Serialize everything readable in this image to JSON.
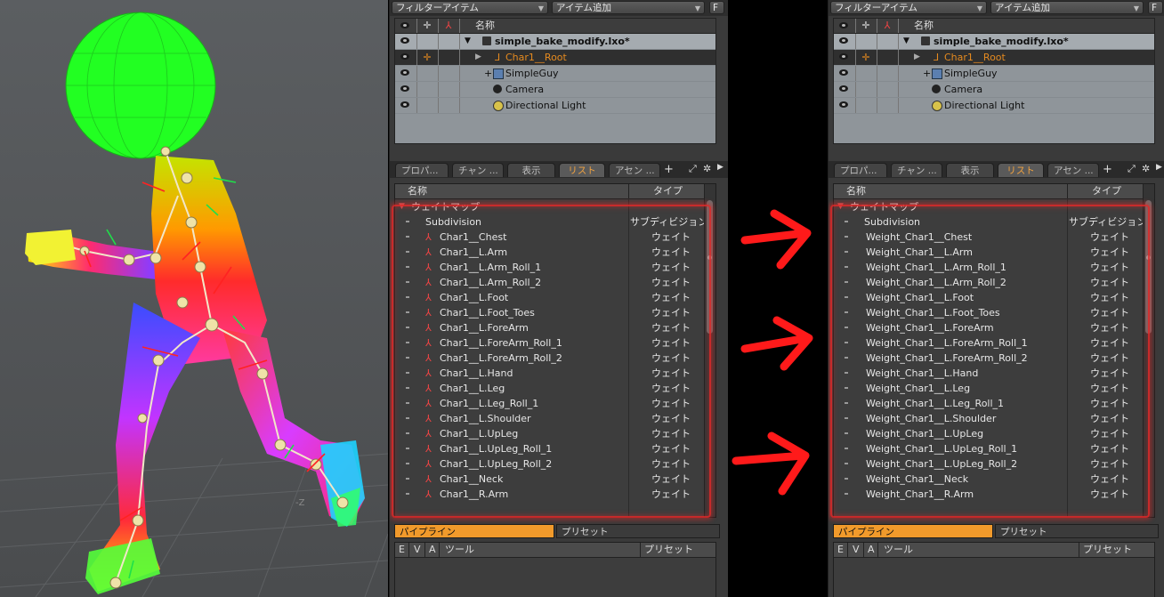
{
  "viewport": {
    "axis_label": "-Z"
  },
  "colors": {
    "panel_bg": "#3a3a3a",
    "outliner_bg": "#8f959a",
    "selected_text": "#e58a1f",
    "active_tab_text": "#f2a340",
    "pipeline_tab_bg": "#f19a2b",
    "highlight_box": "#e02828",
    "arrow": "#ff1a1a"
  },
  "toolbar": {
    "filter_label": "フィルターアイテム",
    "add_item_label": "アイテム追加",
    "f_button": "F"
  },
  "outliner": {
    "name_header": "名称",
    "scene_file": "simple_bake_modify.lxo*",
    "items": [
      {
        "label": "Char1__Root",
        "icon": "locator-icon",
        "selected": true
      },
      {
        "label": "SimpleGuy",
        "icon": "mesh-icon"
      },
      {
        "label": "Camera",
        "icon": "camera-icon"
      },
      {
        "label": "Directional Light",
        "icon": "light-icon"
      }
    ]
  },
  "tabs": [
    "プロパ...",
    "チャン ...",
    "表示",
    "リスト",
    "アセン ..."
  ],
  "active_tab": "リスト",
  "list": {
    "col_name": "名称",
    "col_type": "タイプ",
    "group": "ウェイトマップ",
    "subdivision": {
      "name": "Subdivision",
      "type": "サブディビジョン ..."
    },
    "weight_type": "ウェイト",
    "weights_left": [
      "Char1__Chest",
      "Char1__L.Arm",
      "Char1__L.Arm_Roll_1",
      "Char1__L.Arm_Roll_2",
      "Char1__L.Foot",
      "Char1__L.Foot_Toes",
      "Char1__L.ForeArm",
      "Char1__L.ForeArm_Roll_1",
      "Char1__L.ForeArm_Roll_2",
      "Char1__L.Hand",
      "Char1__L.Leg",
      "Char1__L.Leg_Roll_1",
      "Char1__L.Shoulder",
      "Char1__L.UpLeg",
      "Char1__L.UpLeg_Roll_1",
      "Char1__L.UpLeg_Roll_2",
      "Char1__Neck",
      "Char1__R.Arm"
    ],
    "weights_right": [
      "Weight_Char1__Chest",
      "Weight_Char1__L.Arm",
      "Weight_Char1__L.Arm_Roll_1",
      "Weight_Char1__L.Arm_Roll_2",
      "Weight_Char1__L.Foot",
      "Weight_Char1__L.Foot_Toes",
      "Weight_Char1__L.ForeArm",
      "Weight_Char1__L.ForeArm_Roll_1",
      "Weight_Char1__L.ForeArm_Roll_2",
      "Weight_Char1__L.Hand",
      "Weight_Char1__L.Leg",
      "Weight_Char1__L.Leg_Roll_1",
      "Weight_Char1__L.Shoulder",
      "Weight_Char1__L.UpLeg",
      "Weight_Char1__L.UpLeg_Roll_1",
      "Weight_Char1__L.UpLeg_Roll_2",
      "Weight_Char1__Neck",
      "Weight_Char1__R.Arm"
    ]
  },
  "bottom": {
    "pipeline": "パイプライン",
    "preset": "プリセット",
    "cols": [
      "E",
      "V",
      "A",
      "ツール",
      "プリセット"
    ]
  }
}
